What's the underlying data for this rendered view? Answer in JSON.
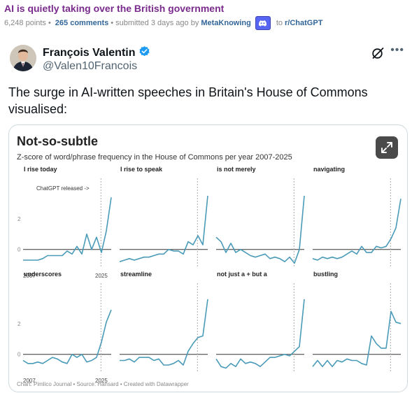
{
  "post": {
    "title": "AI is quietly taking over the British government",
    "points": "6,248 points",
    "comments": "265 comments",
    "submitted": "submitted 3 days ago by",
    "author": "MetaKnowing",
    "to": "to",
    "subreddit": "r/ChatGPT"
  },
  "tweet": {
    "name": "François Valentin",
    "handle": "@Valen10Francois",
    "text": "The surge in AI-written speeches in Britain's House of Commons visualised:",
    "more": "•••"
  },
  "card": {
    "title": "Not-so-subtle",
    "subtitle": "Z-score of word/phrase frequency in the House of Commons per year 2007-2025",
    "footer": "Chart: Pimlico Journal • Source: Hansard • Created with Datawrapper",
    "annotation": "ChatGPT released ->"
  },
  "colors": {
    "line": "#4a9bb8",
    "reddit_title": "#7a2a8c",
    "link": "#336699"
  },
  "chart_data": {
    "type": "line",
    "x": [
      2007,
      2008,
      2009,
      2010,
      2011,
      2012,
      2013,
      2014,
      2015,
      2016,
      2017,
      2018,
      2019,
      2020,
      2021,
      2022,
      2023,
      2024,
      2025
    ],
    "x_tick_labels": [
      "2007",
      "2025"
    ],
    "y_tick_labels": [
      "0",
      "2"
    ],
    "ylim": [
      -1.2,
      4.0
    ],
    "marker_year": 2022.9,
    "series": [
      {
        "name": "I rise today",
        "values": [
          -0.7,
          -0.7,
          -0.7,
          -0.7,
          -0.6,
          -0.4,
          -0.4,
          -0.4,
          -0.4,
          -0.1,
          -0.3,
          0.2,
          -0.3,
          1.0,
          0.0,
          0.8,
          -0.2,
          1.2,
          3.4
        ]
      },
      {
        "name": "I rise to speak",
        "values": [
          -0.8,
          -0.7,
          -0.6,
          -0.7,
          -0.6,
          -0.5,
          -0.5,
          -0.4,
          -0.3,
          -0.3,
          0.0,
          -0.1,
          -0.1,
          -0.3,
          0.5,
          0.3,
          0.9,
          0.3,
          3.5
        ]
      },
      {
        "name": "is not merely",
        "values": [
          0.8,
          0.5,
          -0.2,
          0.4,
          -0.2,
          0.0,
          -0.2,
          -0.4,
          -0.5,
          -0.4,
          -0.3,
          -0.6,
          -0.5,
          -0.6,
          -0.8,
          -0.5,
          -0.9,
          0.0,
          3.5
        ]
      },
      {
        "name": "navigating",
        "values": [
          -0.6,
          -0.7,
          -0.5,
          -0.6,
          -0.5,
          -0.6,
          -0.5,
          -0.3,
          -0.1,
          -0.3,
          0.2,
          -0.2,
          -0.2,
          0.2,
          0.1,
          0.2,
          0.7,
          1.4,
          3.3
        ]
      },
      {
        "name": "underscores",
        "values": [
          -0.4,
          -0.6,
          -0.6,
          -0.5,
          -0.6,
          -0.4,
          -0.2,
          -0.3,
          -0.5,
          -0.6,
          0.0,
          -0.2,
          0.0,
          -0.5,
          -0.4,
          -0.2,
          0.8,
          2.1,
          2.9
        ]
      },
      {
        "name": "streamline",
        "values": [
          -0.4,
          -0.4,
          -0.3,
          -0.5,
          -0.2,
          -0.2,
          -0.2,
          -0.4,
          -0.3,
          -0.7,
          -0.7,
          -0.6,
          -0.4,
          -0.7,
          0.2,
          0.7,
          1.1,
          1.2,
          3.6
        ]
      },
      {
        "name": "not just a + but a",
        "values": [
          -0.3,
          -0.8,
          -0.9,
          -0.6,
          -0.8,
          -0.3,
          -0.6,
          -0.5,
          -0.6,
          -0.8,
          -0.5,
          -0.2,
          -0.2,
          -0.1,
          0.0,
          -0.1,
          0.2,
          0.5,
          3.6
        ]
      },
      {
        "name": "bustling",
        "values": [
          -0.8,
          -0.4,
          -0.8,
          -0.4,
          -0.8,
          -0.4,
          -0.5,
          -0.3,
          -0.4,
          -0.4,
          -0.6,
          -0.7,
          1.2,
          0.7,
          0.4,
          0.4,
          2.8,
          2.1,
          2.0
        ]
      }
    ]
  }
}
